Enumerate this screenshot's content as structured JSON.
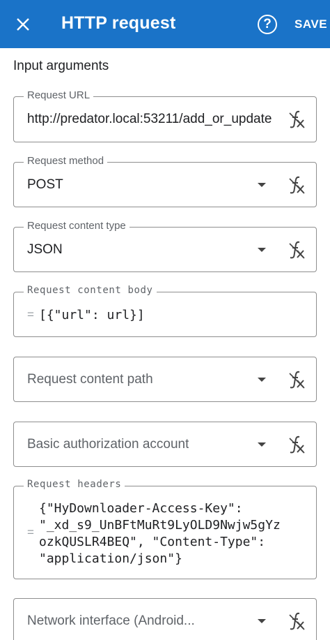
{
  "appbar": {
    "title": "HTTP request",
    "save_label": "SAVE"
  },
  "section_title": "Input arguments",
  "fields": {
    "request_url": {
      "label": "Request URL",
      "value": "http://predator.local:53211/add_or_update"
    },
    "request_method": {
      "label": "Request method",
      "value": "POST"
    },
    "request_content_type": {
      "label": "Request content type",
      "value": "JSON"
    },
    "request_content_body": {
      "label": "Request content body",
      "eq": "=",
      "value": "[{\"url\": url}]"
    },
    "request_content_path": {
      "placeholder": "Request content path"
    },
    "basic_auth_account": {
      "placeholder": "Basic authorization account"
    },
    "request_headers": {
      "label": "Request headers",
      "eq": "=",
      "lines": [
        "{\"HyDownloader-Access-Key\":",
        "\"_xd_s9_UnBFtMuRt9LyOLD9Nwjw5gYz",
        "ozkQUSLR4BEQ\", \"Content-Type\":",
        "\"application/json\"}"
      ]
    },
    "network_interface": {
      "placeholder": "Network interface (Android..."
    }
  },
  "icons": {
    "close": "close-icon",
    "help": "help-icon",
    "dropdown": "arrow-drop-down-icon",
    "function": "function-icon"
  },
  "colors": {
    "appbar": "#1a73c8",
    "border": "#8e8e8e"
  }
}
